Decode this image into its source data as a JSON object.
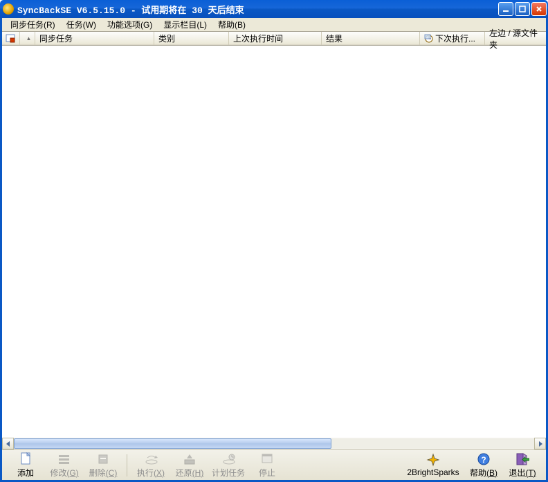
{
  "window": {
    "title": "SyncBackSE V6.5.15.0 - 试用期将在 30 天后结束"
  },
  "menu": {
    "items": [
      {
        "label": "同步任务(R)"
      },
      {
        "label": "任务(W)"
      },
      {
        "label": "功能选项(G)"
      },
      {
        "label": "显示栏目(L)"
      },
      {
        "label": "帮助(B)"
      }
    ]
  },
  "columns": {
    "c0": "",
    "c1": "同步任务",
    "c2": "类别",
    "c3": "上次执行时间",
    "c4": "结果",
    "c5": "下次执行...",
    "c6": "左边 / 源文件夹"
  },
  "toolbar": {
    "add": "添加",
    "edit": {
      "label": "修改",
      "hotkey": "(G)"
    },
    "delete": {
      "label": "删除",
      "hotkey": "(C)"
    },
    "run": {
      "label": "执行",
      "hotkey": "(X)"
    },
    "restore": {
      "label": "还原",
      "hotkey": "(H)"
    },
    "schedule": "计划任务",
    "stop": "停止",
    "company": "2BrightSparks",
    "help": {
      "label": "帮助",
      "hotkey": "(B)"
    },
    "exit": {
      "label": "退出",
      "hotkey": "(T)"
    }
  }
}
